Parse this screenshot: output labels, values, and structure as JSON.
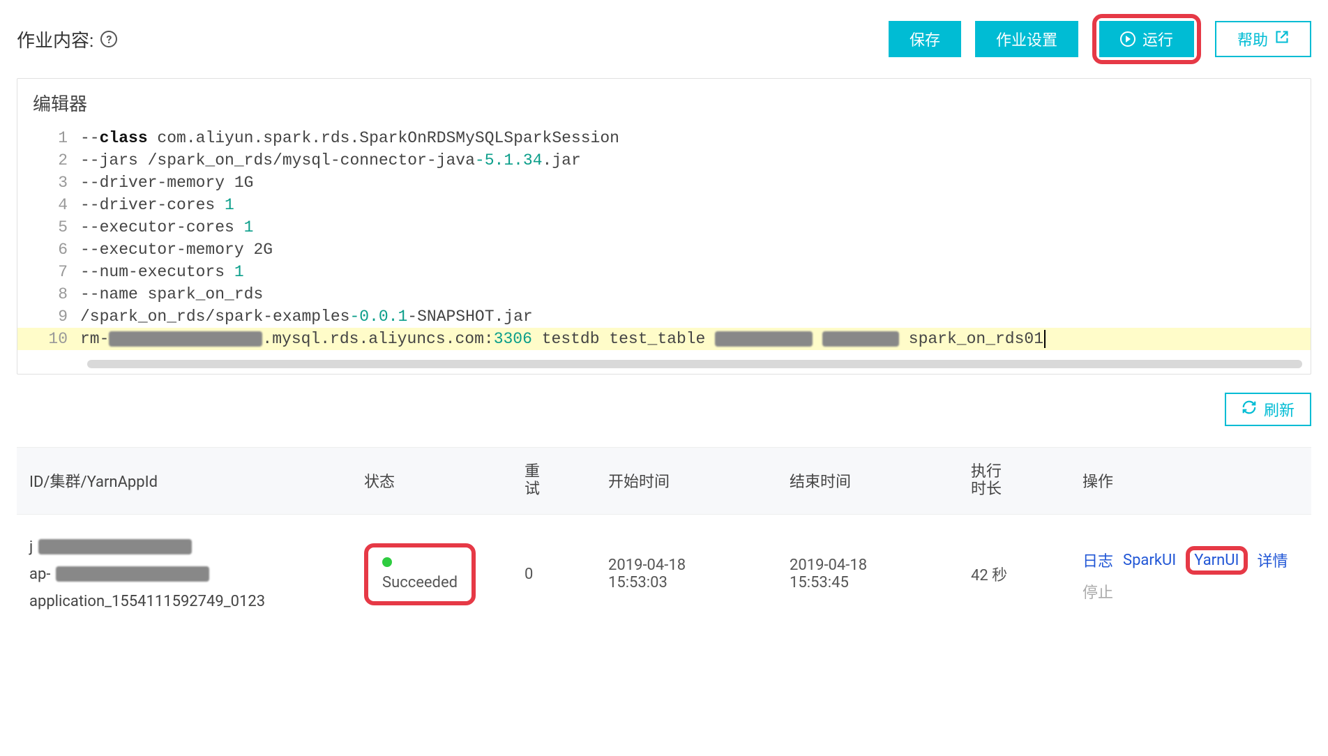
{
  "header": {
    "title": "作业内容:",
    "help_symbol": "?"
  },
  "buttons": {
    "save": "保存",
    "settings": "作业设置",
    "run": "运行",
    "help": "帮助"
  },
  "editor": {
    "title": "编辑器",
    "lines": [
      "--class com.aliyun.spark.rds.SparkOnRDSMySQLSparkSession",
      "--jars /spark_on_rds/mysql-connector-java-5.1.34.jar",
      "--driver-memory 1G",
      "--driver-cores 1",
      "--executor-cores 1",
      "--executor-memory 2G",
      "--num-executors 1",
      "--name spark_on_rds",
      "/spark_on_rds/spark-examples-0.0.1-SNAPSHOT.jar",
      "rm-████████.mysql.rds.aliyuncs.com:3306 testdb test_table ████ ████ spark_on_rds01"
    ],
    "jars_version": "-5.1.34",
    "examples_version": "-0.0.1",
    "port": "3306",
    "cores_driver": "1",
    "cores_executor": "1",
    "num_executors": "1",
    "last_tail": " spark_on_rds01"
  },
  "refresh": {
    "label": "刷新"
  },
  "table": {
    "headers": {
      "id": "ID/集群/YarnAppId",
      "status": "状态",
      "retry_l1": "重",
      "retry_l2": "试",
      "start": "开始时间",
      "end": "结束时间",
      "dur_l1": "执行",
      "dur_l2": "时长",
      "ops": "操作"
    },
    "row": {
      "id_prefix1": "j",
      "id_prefix2": "ap-",
      "app_id": "application_1554111592749_0123",
      "status_label": "Succeeded",
      "retry": "0",
      "start_l1": "2019-04-18",
      "start_l2": "15:53:03",
      "end_l1": "2019-04-18",
      "end_l2": "15:53:45",
      "duration": "42 秒",
      "ops": {
        "log": "日志",
        "spark": "SparkUI",
        "yarn": "YarnUI",
        "detail": "详情",
        "stop": "停止"
      }
    }
  }
}
